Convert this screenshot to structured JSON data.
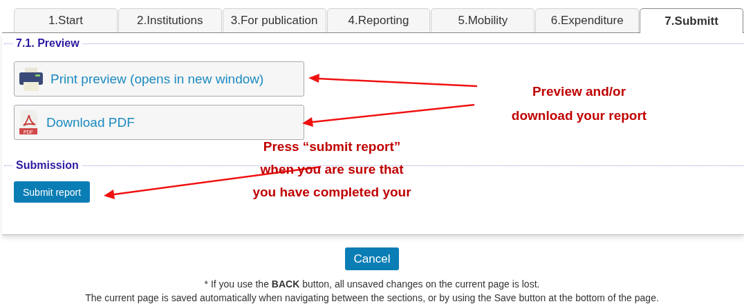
{
  "tabs": [
    {
      "label": "1.Start",
      "selected": false
    },
    {
      "label": "2.Institutions",
      "selected": false
    },
    {
      "label": "3.For publication",
      "selected": false
    },
    {
      "label": "4.Reporting",
      "selected": false
    },
    {
      "label": "5.Mobility",
      "selected": false
    },
    {
      "label": "6.Expenditure",
      "selected": false
    },
    {
      "label": "7.Submitt",
      "selected": true
    }
  ],
  "preview": {
    "legend": "7.1. Preview",
    "buttons": [
      {
        "kind": "print",
        "label": "Print preview (opens in new window)"
      },
      {
        "kind": "pdf",
        "label": "Download PDF",
        "icon_text": "PDF"
      }
    ]
  },
  "submission": {
    "legend": "Submission",
    "button": "Submit report"
  },
  "cancel_button": "Cancel",
  "notes": [
    "* If you use the **BACK** button, all unsaved changes on the current page is lost.",
    "The current page is saved automatically when navigating between the sections, or by using the Save button at the bottom of the page."
  ],
  "annotations": [
    {
      "lines": [
        "Preview and/or",
        "download your report"
      ]
    },
    {
      "lines": [
        "Press “submit report”",
        "when you are sure that",
        "you have completed your"
      ]
    }
  ]
}
